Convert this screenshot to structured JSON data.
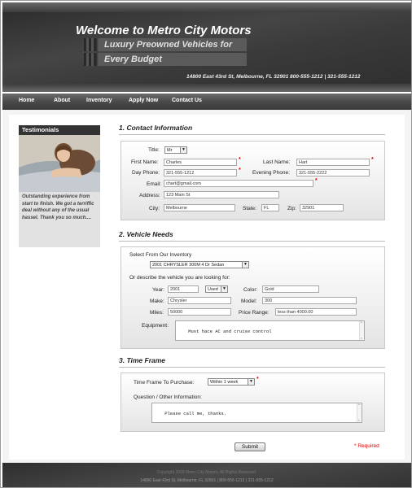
{
  "header": {
    "title": "Welcome to Metro City Motors",
    "tagline_line1": "Luxury Preowned Vehicles for",
    "tagline_line2": "Every Budget",
    "contact": "14800 East 43rd St,   Melbourne,   FL  32901     800-555-1212     |   321-555-1212"
  },
  "nav": {
    "items": [
      {
        "label": "Home"
      },
      {
        "label": "About"
      },
      {
        "label": "Inventory"
      },
      {
        "label": "Apply Now"
      },
      {
        "label": "Contact Us"
      }
    ]
  },
  "sidebar": {
    "heading": "Testimonials",
    "quote": "Outstanding experience from start to finish. We got a terriffic deal without any of the usual hassel. Thank you so much...."
  },
  "contact_section": {
    "title": "1. Contact Information",
    "title_label": "Title:",
    "title_value": "Mr",
    "first_name_label": "First Name:",
    "first_name_value": "Charles",
    "last_name_label": "Last Name:",
    "last_name_value": "Hart",
    "day_phone_label": "Day Phone:",
    "day_phone_value": "321-555-1212",
    "evening_phone_label": "Evening Phone:",
    "evening_phone_value": "321-555-2222",
    "email_label": "Email:",
    "email_value": "chart@gmail.com",
    "address_label": "Address:",
    "address_value": "123 Main St",
    "city_label": "City:",
    "city_value": "Melbourne",
    "state_label": "State:",
    "state_value": "FL",
    "zip_label": "Zip:",
    "zip_value": "32901",
    "required_marker": "*"
  },
  "vehicle_section": {
    "title": "2. Vehicle Needs",
    "inventory_label": "Select From Our Inventory",
    "inventory_value": "2001 CHRYSLER 300M 4 Dr Sedan",
    "describe_label": "Or describe the vehicle you are looking for:",
    "year_label": "Year:",
    "year_value": "2001",
    "condition_value": "Used",
    "color_label": "Color:",
    "color_value": "Gold",
    "make_label": "Make:",
    "make_value": "Chrysler",
    "model_label": "Model:",
    "model_value": "300",
    "miles_label": "Miles:",
    "miles_value": "50000",
    "price_label": "Price Range:",
    "price_value": "less than 4000.00",
    "equipment_label": "Equipment:",
    "equipment_value": "Must hace AC and cruise control"
  },
  "time_section": {
    "title": "3. Time Frame",
    "timeframe_label": "Time Frame To Purchase:",
    "timeframe_value": "Within 1 week",
    "question_label": "Question / Other Information:",
    "question_value": "Please call me, thanks."
  },
  "form": {
    "submit_label": "Submit",
    "required_note": "* Required",
    "dropdown_arrow": "▼"
  },
  "footer": {
    "copyright": "Copyright 2009 Metro City Motors. All Rights Reserved.",
    "address": "14800 East 43rd St, Melbourne, FL 32901   |   800-555-1212   |   321-555-1212"
  },
  "colors": {
    "header_bg": "#3d3d3d",
    "required": "#dd0000",
    "panel_gradient_end": "#e4e4e4"
  }
}
